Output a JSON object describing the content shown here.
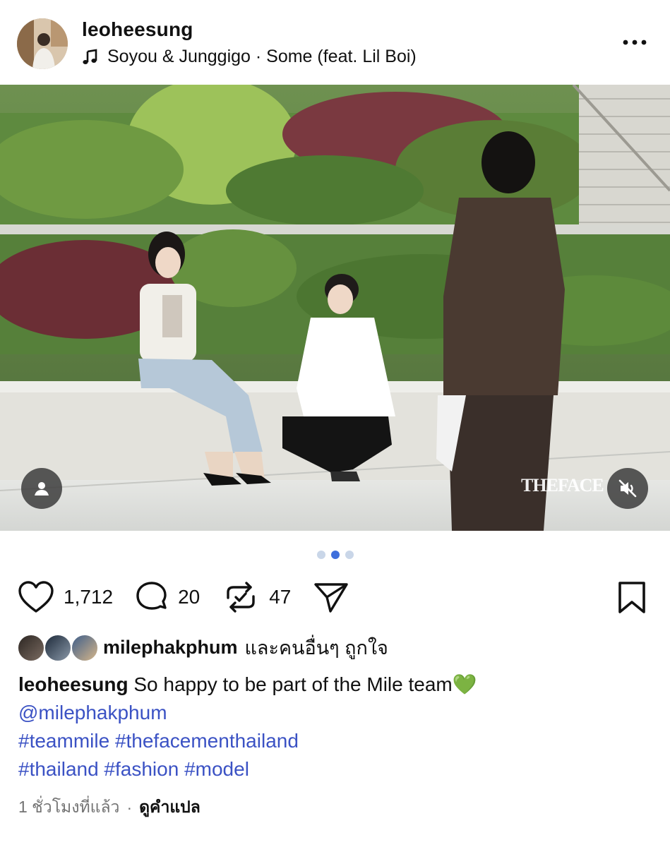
{
  "post": {
    "username": "leoheesung",
    "music": "Soyou & Junggigo · Some (feat. Lil Boi)",
    "watermark": "THEFACE",
    "carousel": {
      "count": 3,
      "active_index": 1
    },
    "actions": {
      "likes": "1,712",
      "comments": "20",
      "reposts": "47"
    },
    "liked_by": {
      "user": "milephakphum",
      "rest": "และคนอื่นๆ ถูกใจ"
    },
    "caption": {
      "user": "leoheesung",
      "text": "So happy to be part of the Mile team💚",
      "mention": "@milephakphum",
      "hashtags_line1": "#teammile #thefacementhailand",
      "hashtags_line2": "#thailand #fashion #model"
    },
    "meta": {
      "time": "1 ชั่วโมงที่แล้ว",
      "separator": "·",
      "translate": "ดูคำแปล"
    }
  },
  "colors": {
    "link": "#3b52c4",
    "dot_active": "#3f6fdc",
    "dot_inactive": "#c9d6e8",
    "muted_text": "#737373"
  },
  "icons": [
    "more-icon",
    "music-note-icon",
    "heart-icon",
    "comment-icon",
    "repost-icon",
    "share-icon",
    "bookmark-icon",
    "person-tag-icon",
    "muted-speaker-icon"
  ]
}
